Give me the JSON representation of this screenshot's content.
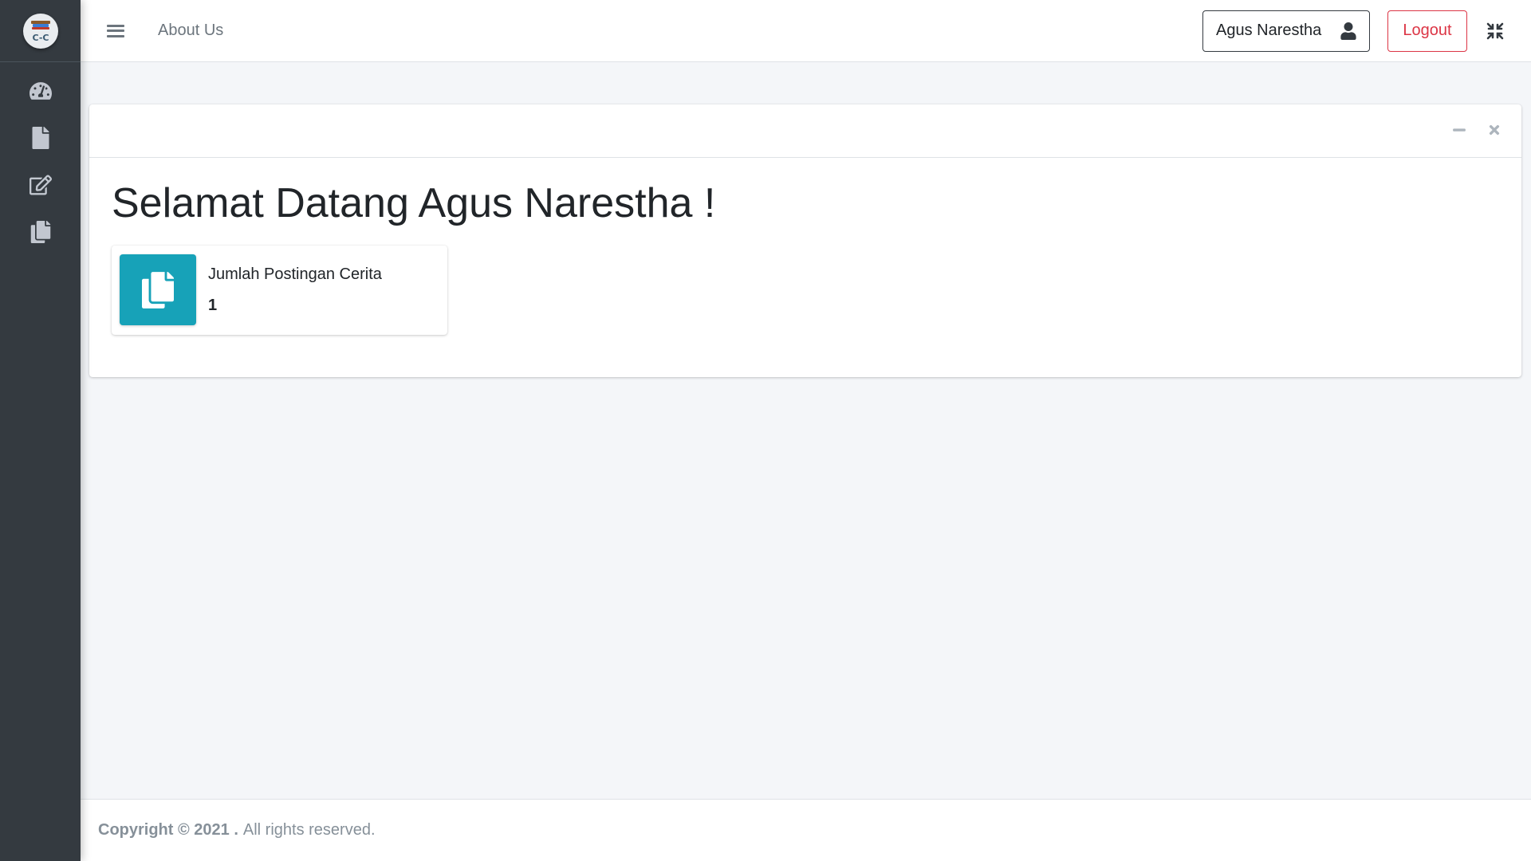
{
  "sidebar": {
    "logo_text": "C-C",
    "items": [
      {
        "icon": "dashboard-icon"
      },
      {
        "icon": "file-icon"
      },
      {
        "icon": "edit-icon"
      },
      {
        "icon": "copy-icon"
      }
    ]
  },
  "header": {
    "menu_icon": "hamburger-icon",
    "nav_link": "About Us",
    "user_name": "Agus Narestha",
    "user_icon": "user-icon",
    "logout_label": "Logout",
    "fullscreen_icon": "compress-icon"
  },
  "card": {
    "tools": [
      "minus-icon",
      "close-icon"
    ],
    "welcome": "Selamat Datang Agus Narestha !",
    "info_box": {
      "icon": "copy-icon",
      "label": "Jumlah Postingan Cerita",
      "value": "1",
      "color": "#17a2b8"
    }
  },
  "footer": {
    "copyright": "Copyright © 2021 .",
    "rights": "All rights reserved."
  },
  "colors": {
    "sidebar_bg": "#343a40",
    "accent_info": "#17a2b8",
    "danger": "#dc3545",
    "page_bg": "#f4f6f9"
  }
}
